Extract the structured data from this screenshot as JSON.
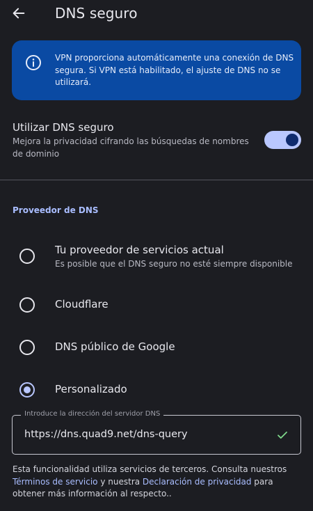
{
  "header": {
    "title": "DNS seguro",
    "back_icon": "arrow-left-icon"
  },
  "info_card": {
    "icon": "info-icon",
    "text": "VPN proporciona automáticamente una conexión de DNS segura. Si VPN está habilitado, el ajuste de DNS no se utilizará.",
    "background_color": "#0a4aa3"
  },
  "secure_dns": {
    "title": "Utilizar DNS seguro",
    "subtitle": "Mejora la privacidad cifrando las búsquedas de nombres de dominio",
    "enabled": true
  },
  "provider_section": {
    "header": "Proveedor de DNS",
    "options": [
      {
        "label": "Tu proveedor de servicios actual",
        "sublabel": "Es posible que el DNS seguro no esté siempre disponible",
        "selected": false
      },
      {
        "label": "Cloudflare",
        "selected": false
      },
      {
        "label": "DNS público de Google",
        "selected": false
      },
      {
        "label": "Personalizado",
        "selected": true
      }
    ]
  },
  "custom_dns": {
    "label": "Introduce la dirección del servidor DNS",
    "value": "https://dns.quad9.net/dns-query",
    "valid_icon": "check-icon"
  },
  "footer": {
    "text_1": "Esta funcionalidad utiliza servicios de terceros. Consulta nuestros ",
    "terms_link": "Términos de servicio",
    "text_2": " y nuestra ",
    "privacy_link": "Declaración de privacidad",
    "text_3": " para obtener más información al respecto.."
  },
  "colors": {
    "background": "#1c1d22",
    "accent": "#b9c7ff",
    "link": "#a9bdff",
    "check": "#7fd98c"
  }
}
